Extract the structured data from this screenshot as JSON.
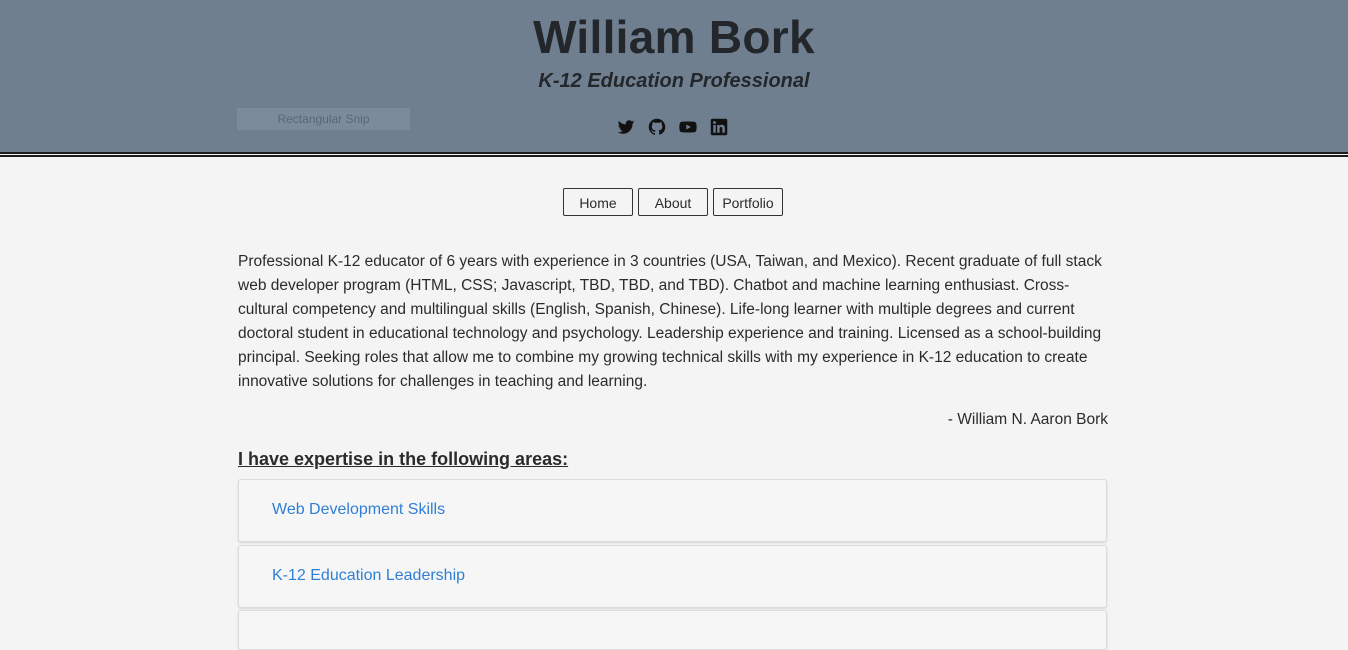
{
  "header": {
    "name": "William Bork",
    "tagline": "K-12 Education Professional",
    "overlay_text": "Rectangular Snip",
    "background_color": "#6f7f90",
    "social_icons": [
      "twitter-icon",
      "github-icon",
      "youtube-icon",
      "linkedin-icon"
    ]
  },
  "nav": {
    "home": "Home",
    "about": "About",
    "portfolio": "Portfolio"
  },
  "bio": {
    "text": "Professional K-12 educator of 6 years with experience in 3 countries (USA, Taiwan, and Mexico). Recent graduate of full stack web developer program (HTML, CSS; Javascript, TBD, TBD, and TBD). Chatbot and machine learning enthusiast. Cross-cultural competency and multilingual skills (English, Spanish, Chinese). Life-long learner with multiple degrees and current doctoral student in educational technology and psychology. Leadership experience and training. Licensed as a school-building principal. Seeking roles that allow me to combine my growing technical skills with my experience in K-12 education to create innovative solutions for challenges in teaching and learning.",
    "signature": "- William N. Aaron Bork"
  },
  "expertise": {
    "heading": "I have expertise in the following areas:",
    "items": [
      "Web Development Skills",
      "K-12 Education Leadership"
    ],
    "link_color": "#2f7fd6"
  }
}
